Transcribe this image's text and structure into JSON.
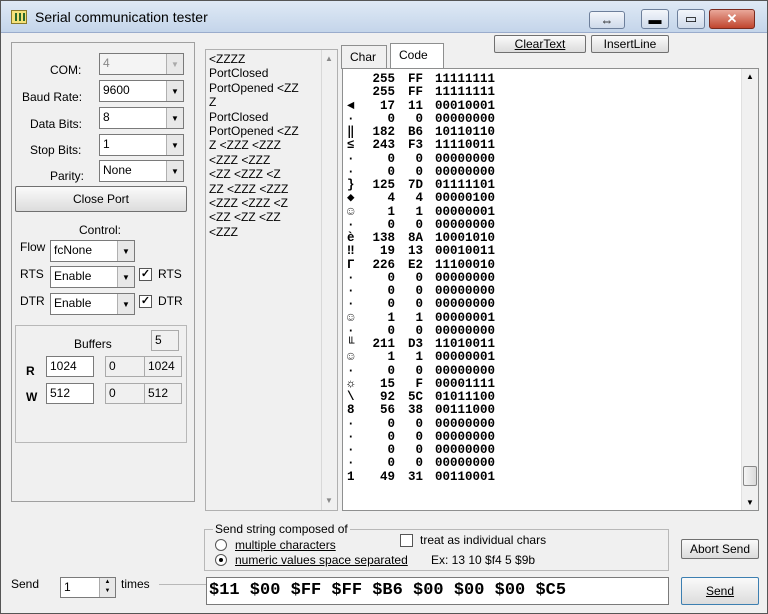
{
  "window": {
    "title": "Serial communication tester",
    "controls": {
      "restore": "⇔",
      "minimize": "▬",
      "maximize": "▭",
      "close": "✕"
    }
  },
  "port": {
    "com_label": "COM:",
    "com_value": "4",
    "baud_label": "Baud Rate:",
    "baud_value": "9600",
    "databits_label": "Data Bits:",
    "databits_value": "8",
    "stopbits_label": "Stop Bits:",
    "stopbits_value": "1",
    "parity_label": "Parity:",
    "parity_value": "None",
    "close_button": "Close Port"
  },
  "control": {
    "title": "Control:",
    "flow_label": "Flow",
    "flow_value": "fcNone",
    "rts_label": "RTS",
    "rts_value": "Enable",
    "rts_check_label": "RTS",
    "rts_checked": true,
    "dtr_label": "DTR",
    "dtr_value": "Enable",
    "dtr_check_label": "DTR",
    "dtr_checked": true
  },
  "buffers": {
    "title": "Buffers",
    "count": "5",
    "r_label": "R",
    "r_size": "1024",
    "r_used": "0",
    "r_max": "1024",
    "w_label": "W",
    "w_size": "512",
    "w_used": "0",
    "w_max": "512"
  },
  "log_lines": [
    "<ZZZZ",
    "PortClosed",
    "PortOpened <ZZ",
    "Z",
    "PortClosed",
    "PortOpened <ZZ",
    "Z <ZZZ <ZZZ",
    "<ZZZ <ZZZ",
    "<ZZ <ZZZ <Z",
    "ZZ <ZZZ <ZZZ",
    "<ZZZ <ZZZ <Z",
    "<ZZ <ZZ <ZZ",
    "<ZZZ"
  ],
  "tabs": [
    {
      "label": "Char"
    },
    {
      "label": "Code",
      "active": true
    }
  ],
  "toolbar": {
    "clear_text": "ClearText",
    "insert_line": "InsertLine"
  },
  "code_rows": [
    {
      "ch": "",
      "dec": "255",
      "hex": "FF",
      "bin": "11111111"
    },
    {
      "ch": "",
      "dec": "255",
      "hex": "FF",
      "bin": "11111111"
    },
    {
      "ch": "◄",
      "dec": "17",
      "hex": "11",
      "bin": "00010001"
    },
    {
      "ch": "·",
      "dec": "0",
      "hex": "0",
      "bin": "00000000"
    },
    {
      "ch": "‖",
      "dec": "182",
      "hex": "B6",
      "bin": "10110110"
    },
    {
      "ch": "≤",
      "dec": "243",
      "hex": "F3",
      "bin": "11110011"
    },
    {
      "ch": "·",
      "dec": "0",
      "hex": "0",
      "bin": "00000000"
    },
    {
      "ch": "·",
      "dec": "0",
      "hex": "0",
      "bin": "00000000"
    },
    {
      "ch": "}",
      "dec": "125",
      "hex": "7D",
      "bin": "01111101"
    },
    {
      "ch": "◆",
      "dec": "4",
      "hex": "4",
      "bin": "00000100"
    },
    {
      "ch": "☺",
      "dec": "1",
      "hex": "1",
      "bin": "00000001"
    },
    {
      "ch": "·",
      "dec": "0",
      "hex": "0",
      "bin": "00000000"
    },
    {
      "ch": "è",
      "dec": "138",
      "hex": "8A",
      "bin": "10001010"
    },
    {
      "ch": "‼",
      "dec": "19",
      "hex": "13",
      "bin": "00010011"
    },
    {
      "ch": "Γ",
      "dec": "226",
      "hex": "E2",
      "bin": "11100010"
    },
    {
      "ch": "·",
      "dec": "0",
      "hex": "0",
      "bin": "00000000"
    },
    {
      "ch": "·",
      "dec": "0",
      "hex": "0",
      "bin": "00000000"
    },
    {
      "ch": "·",
      "dec": "0",
      "hex": "0",
      "bin": "00000000"
    },
    {
      "ch": "☺",
      "dec": "1",
      "hex": "1",
      "bin": "00000001"
    },
    {
      "ch": "·",
      "dec": "0",
      "hex": "0",
      "bin": "00000000"
    },
    {
      "ch": "╙",
      "dec": "211",
      "hex": "D3",
      "bin": "11010011"
    },
    {
      "ch": "☺",
      "dec": "1",
      "hex": "1",
      "bin": "00000001"
    },
    {
      "ch": "·",
      "dec": "0",
      "hex": "0",
      "bin": "00000000"
    },
    {
      "ch": "☼",
      "dec": "15",
      "hex": "F",
      "bin": "00001111"
    },
    {
      "ch": "\\",
      "dec": "92",
      "hex": "5C",
      "bin": "01011100"
    },
    {
      "ch": "8",
      "dec": "56",
      "hex": "38",
      "bin": "00111000"
    },
    {
      "ch": "·",
      "dec": "0",
      "hex": "0",
      "bin": "00000000"
    },
    {
      "ch": "·",
      "dec": "0",
      "hex": "0",
      "bin": "00000000"
    },
    {
      "ch": "·",
      "dec": "0",
      "hex": "0",
      "bin": "00000000"
    },
    {
      "ch": "·",
      "dec": "0",
      "hex": "0",
      "bin": "00000000"
    },
    {
      "ch": "1",
      "dec": "49",
      "hex": "31",
      "bin": "00110001"
    }
  ],
  "send": {
    "group_title": "Send string composed of",
    "opt_multiple": "multiple characters",
    "opt_numeric": "numeric values space separated",
    "example": "Ex:  13 10 $f4 5 $9b",
    "treat_individual": "treat as individual chars",
    "abort_button": "Abort Send",
    "send_button": "Send",
    "send_label": "Send",
    "times_value": "1",
    "times_label": "times",
    "input_value": "$11 $00 $FF $FF $B6 $00 $00 $00 $C5"
  }
}
